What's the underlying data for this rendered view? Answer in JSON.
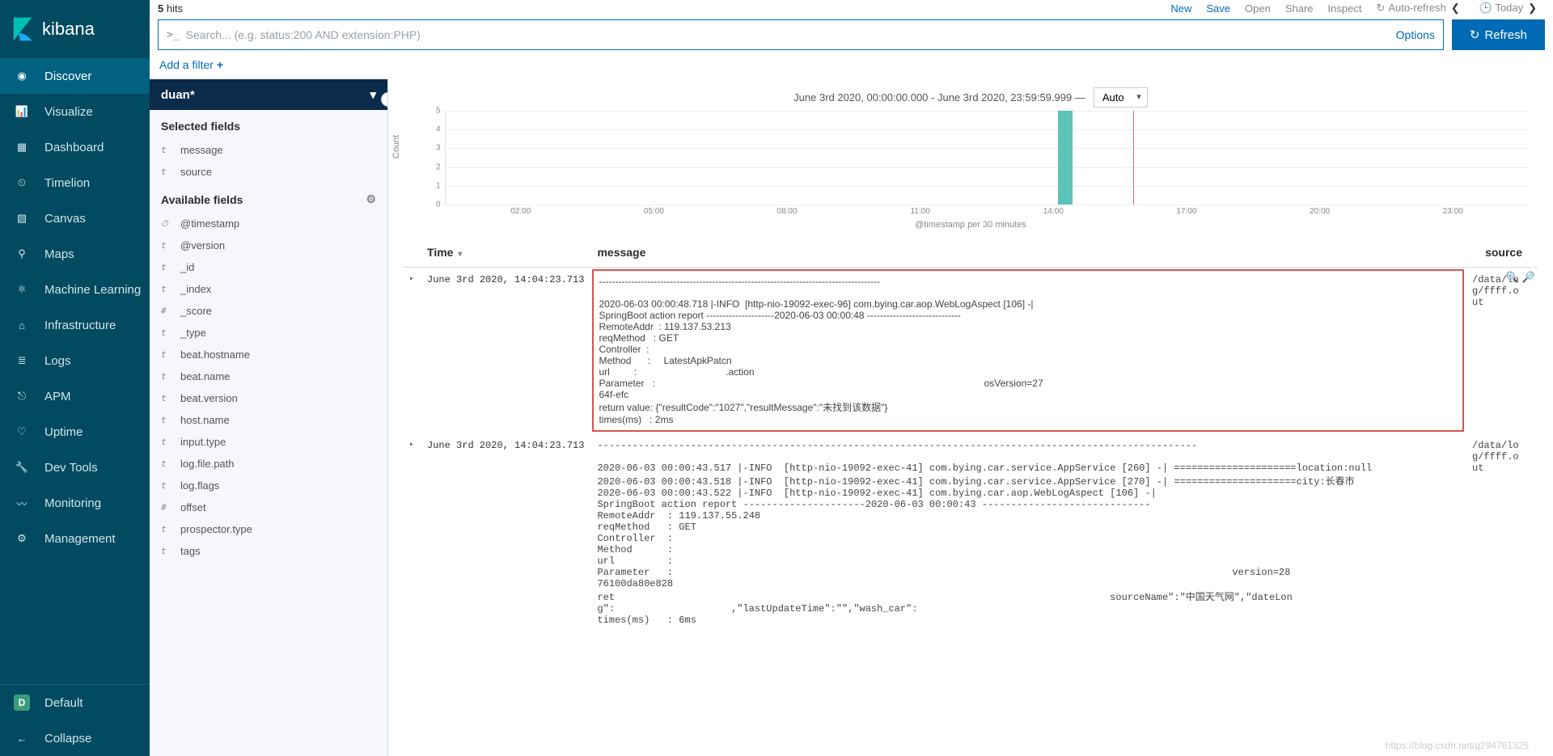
{
  "brand": "kibana",
  "nav": {
    "items": [
      {
        "label": "Discover",
        "active": true
      },
      {
        "label": "Visualize"
      },
      {
        "label": "Dashboard"
      },
      {
        "label": "Timelion"
      },
      {
        "label": "Canvas"
      },
      {
        "label": "Maps"
      },
      {
        "label": "Machine Learning"
      },
      {
        "label": "Infrastructure"
      },
      {
        "label": "Logs"
      },
      {
        "label": "APM"
      },
      {
        "label": "Uptime"
      },
      {
        "label": "Dev Tools"
      },
      {
        "label": "Monitoring"
      },
      {
        "label": "Management"
      }
    ],
    "footer": {
      "default": "Default",
      "default_badge": "D",
      "collapse": "Collapse"
    }
  },
  "toolbar": {
    "hits_count": "5",
    "hits_label": "hits",
    "new": "New",
    "save": "Save",
    "open": "Open",
    "share": "Share",
    "inspect": "Inspect",
    "auto_refresh": "Auto-refresh",
    "today": "Today"
  },
  "search": {
    "placeholder": "Search... (e.g. status:200 AND extension:PHP)",
    "options": "Options",
    "refresh": "Refresh"
  },
  "filter": {
    "add": "Add a filter"
  },
  "index": {
    "name": "duan*"
  },
  "fields": {
    "selected_title": "Selected fields",
    "available_title": "Available fields",
    "selected": [
      {
        "type": "t",
        "name": "message"
      },
      {
        "type": "t",
        "name": "source"
      }
    ],
    "available": [
      {
        "type": "⏱",
        "name": "@timestamp"
      },
      {
        "type": "t",
        "name": "@version"
      },
      {
        "type": "t",
        "name": "_id"
      },
      {
        "type": "t",
        "name": "_index"
      },
      {
        "type": "#",
        "name": "_score"
      },
      {
        "type": "t",
        "name": "_type"
      },
      {
        "type": "t",
        "name": "beat.hostname"
      },
      {
        "type": "t",
        "name": "beat.name"
      },
      {
        "type": "t",
        "name": "beat.version"
      },
      {
        "type": "t",
        "name": "host.name"
      },
      {
        "type": "t",
        "name": "input.type"
      },
      {
        "type": "t",
        "name": "log.file.path"
      },
      {
        "type": "t",
        "name": "log.flags"
      },
      {
        "type": "#",
        "name": "offset"
      },
      {
        "type": "t",
        "name": "prospector.type"
      },
      {
        "type": "t",
        "name": "tags"
      }
    ]
  },
  "chart": {
    "range_label": "June 3rd 2020, 00:00:00.000 - June 3rd 2020, 23:59:59.999 —",
    "interval": "Auto",
    "y_label": "Count",
    "x_label": "@timestamp per 30 minutes"
  },
  "chart_data": {
    "type": "bar",
    "categories": [
      "02:00",
      "05:00",
      "08:00",
      "11:00",
      "14:00",
      "17:00",
      "20:00",
      "23:00"
    ],
    "ylim": [
      0,
      5
    ],
    "y_ticks": [
      0,
      1,
      2,
      3,
      4,
      5
    ],
    "series": [
      {
        "name": "Count",
        "bars": [
          {
            "x_pct": 56.5,
            "value": 5
          }
        ]
      }
    ],
    "marker_x_pct": 63.5,
    "xlabel": "@timestamp per 30 minutes",
    "ylabel": "Count"
  },
  "table": {
    "columns": {
      "time": "Time",
      "message": "message",
      "source": "source"
    },
    "rows": [
      {
        "time": "June 3rd 2020, 14:04:23.713",
        "highlighted": true,
        "message": "---------------------------------------------------------------------------------------\n\n2020-06-03 00:00:48.718 |-INFO  [http-nio-19092-exec-96] com.bying.car.aop.WebLogAspect [106] -|\nSpringBoot action report ---------------------2020-06-03 00:00:48 -----------------------------\nRemoteAddr  : 119.137.53.213\nreqMethod   : GET\nController  :                                                   \nMethod      :     LatestApkPatcn\nurl         :                                 .action\nParameter   :                                                                                                                          osVersion=27\n64f-efc                                                                             \nreturn value: {\"resultCode\":\"1027\",\"resultMessage\":\"未找到该数据\"}\ntimes(ms)   : 2ms",
        "source": "/data/lo\ng/ffff.o\nut"
      },
      {
        "time": "June 3rd 2020, 14:04:23.713",
        "message": "-------------------------------------------------------------------------------------------------------\n\n2020-06-03 00:00:43.517 |-INFO  [http-nio-19092-exec-41] com.bying.car.service.AppService [260] -| =====================location:null\n2020-06-03 00:00:43.518 |-INFO  [http-nio-19092-exec-41] com.bying.car.service.AppService [270] -| =====================city:长春市\n2020-06-03 00:00:43.522 |-INFO  [http-nio-19092-exec-41] com.bying.car.aop.WebLogAspect [106] -|\nSpringBoot action report ---------------------2020-06-03 00:00:43 -----------------------------\nRemoteAddr  : 119.137.55.248\nreqMethod   : GET\nController  :                                                                           \nMethod      :                                                                           \nurl         :                                                                           \nParameter   :                                                                                                version=28\n76100da80e828                                                                           \nret                                                                                     sourceName\":\"中国天气网\",\"dateLon\ng\":                    ,\"lastUpdateTime\":\"\",\"wash_car\":                    \ntimes(ms)   : 6ms",
        "source": "/data/lo\ng/ffff.o\nut"
      }
    ]
  },
  "watermark": "https://blog.csdn.net/q294761325"
}
